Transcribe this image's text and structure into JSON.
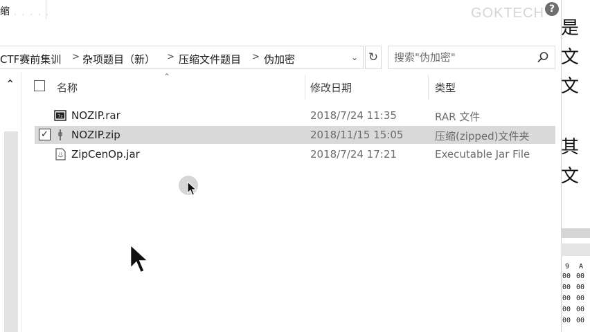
{
  "window": {
    "title_fragment": "缩",
    "watermark": "GOKTECH"
  },
  "address_bar": {
    "crumbs": [
      "CTF赛前集训",
      "杂项题目（新）",
      "压缩文件题目",
      "伪加密"
    ]
  },
  "search": {
    "placeholder": "搜索\"伪加密\""
  },
  "columns": {
    "name": "名称",
    "modified": "修改日期",
    "type": "类型"
  },
  "files": [
    {
      "name": "NOZIP.rar",
      "modified": "2018/7/24 11:35",
      "type": "RAR 文件",
      "icon": "rar-file-icon",
      "checked": false,
      "selected": false
    },
    {
      "name": "NOZIP.zip",
      "modified": "2018/11/15 15:05",
      "type": "压缩(zipped)文件夹",
      "icon": "zip-file-icon",
      "checked": true,
      "selected": true
    },
    {
      "name": "ZipCenOp.jar",
      "modified": "2018/7/24 17:21",
      "type": "Executable Jar File",
      "icon": "jar-file-icon",
      "checked": false,
      "selected": false
    }
  ],
  "background_window": {
    "chars": [
      "是",
      "文",
      "文",
      "其",
      "文"
    ],
    "hex_header": [
      "9",
      "A"
    ],
    "hex_rows": [
      "00",
      "00",
      "00",
      "00",
      "00",
      "00",
      "00"
    ]
  },
  "colors": {
    "selected_row": "#d9d9d9",
    "border": "#d9d9d9",
    "secondary_text": "#6b6b6b"
  }
}
